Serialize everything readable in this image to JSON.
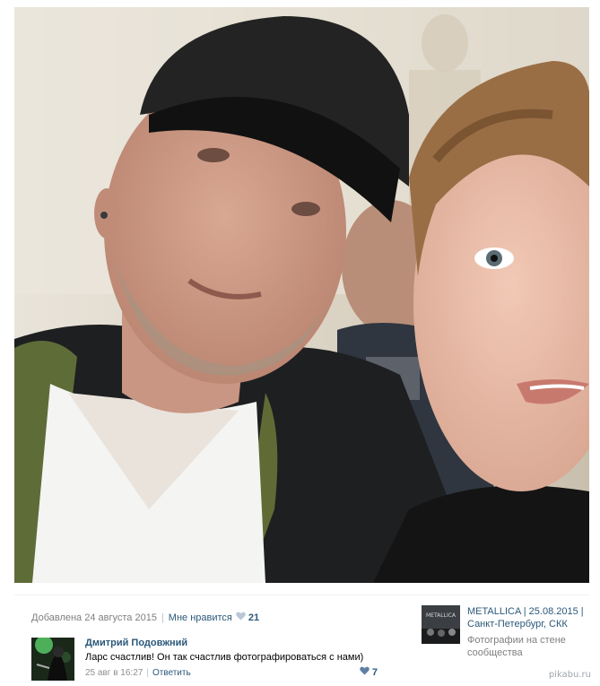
{
  "photo": {
    "caption_added": "Добавлена 24 августа 2015",
    "like_label": "Мне нравится",
    "like_count": "21"
  },
  "comment": {
    "author": "Дмитрий Подовжний",
    "text": "Ларс счастлив! Он так счастлив фотографироваться с нами)",
    "date": "25 авг в 16:27",
    "reply_label": "Ответить",
    "like_count": "7"
  },
  "album": {
    "thumb_label": "METALLICA",
    "link_text": "METALLICA | 25.08.2015 | Санкт-Петербург, СКК",
    "caption": "Фотографии на стене сообщества"
  },
  "watermark": "pikabu.ru",
  "colors": {
    "link": "#2b587a",
    "muted": "#7f7f7f",
    "heart": "#b9c7d6"
  },
  "icons": {
    "heart": "heart-icon"
  }
}
